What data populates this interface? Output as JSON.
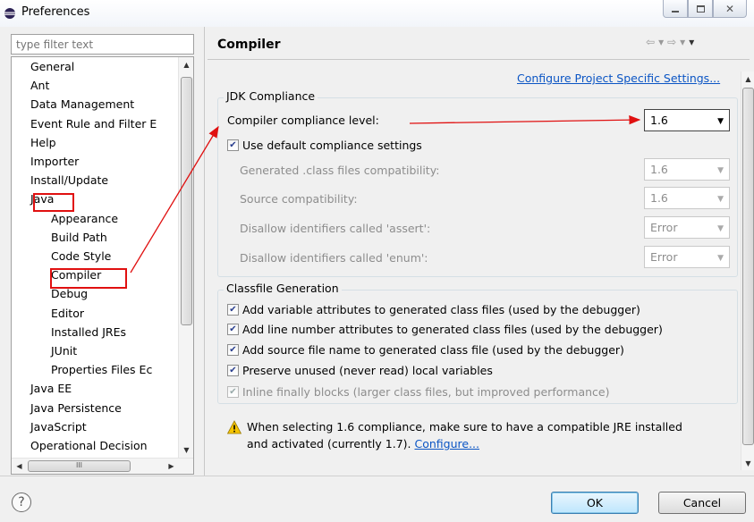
{
  "window": {
    "title": "Preferences"
  },
  "filter": {
    "placeholder": "type filter text"
  },
  "tree": {
    "items": [
      {
        "label": "General",
        "level": 0
      },
      {
        "label": "Ant",
        "level": 0
      },
      {
        "label": "Data Management",
        "level": 0
      },
      {
        "label": "Event Rule and Filter E",
        "level": 0
      },
      {
        "label": "Help",
        "level": 0
      },
      {
        "label": "Importer",
        "level": 0
      },
      {
        "label": "Install/Update",
        "level": 0
      },
      {
        "label": "Java",
        "level": 0,
        "highlight": true
      },
      {
        "label": "Appearance",
        "level": 1
      },
      {
        "label": "Build Path",
        "level": 1
      },
      {
        "label": "Code Style",
        "level": 1
      },
      {
        "label": "Compiler",
        "level": 1,
        "selected": true
      },
      {
        "label": "Debug",
        "level": 1
      },
      {
        "label": "Editor",
        "level": 1
      },
      {
        "label": "Installed JREs",
        "level": 1
      },
      {
        "label": "JUnit",
        "level": 1
      },
      {
        "label": "Properties Files Ec",
        "level": 1
      },
      {
        "label": "Java EE",
        "level": 0
      },
      {
        "label": "Java Persistence",
        "level": 0
      },
      {
        "label": "JavaScript",
        "level": 0
      },
      {
        "label": "Operational Decision",
        "level": 0
      }
    ],
    "hscroll_grip": "III"
  },
  "page": {
    "title": "Compiler",
    "project_link": "Configure Project Specific Settings...",
    "jdk_group": {
      "label": "JDK Compliance",
      "compliance_label": "Compiler compliance level:",
      "compliance_value": "1.6",
      "use_default_label": "Use default compliance settings",
      "use_default_checked": true,
      "rows": [
        {
          "label": "Generated .class files compatibility:",
          "value": "1.6"
        },
        {
          "label": "Source compatibility:",
          "value": "1.6"
        },
        {
          "label": "Disallow identifiers called 'assert':",
          "value": "Error"
        },
        {
          "label": "Disallow identifiers called 'enum':",
          "value": "Error"
        }
      ]
    },
    "classfile_group": {
      "label": "Classfile Generation",
      "options": [
        {
          "label": "Add variable attributes to generated class files (used by the debugger)",
          "checked": true,
          "enabled": true
        },
        {
          "label": "Add line number attributes to generated class files (used by the debugger)",
          "checked": true,
          "enabled": true
        },
        {
          "label": "Add source file name to generated class file (used by the debugger)",
          "checked": true,
          "enabled": true
        },
        {
          "label": "Preserve unused (never read) local variables",
          "checked": true,
          "enabled": true
        },
        {
          "label": "Inline finally blocks (larger class files, but improved performance)",
          "checked": true,
          "enabled": false
        }
      ]
    },
    "warning": {
      "text_line1": "When selecting 1.6 compliance, make sure to have a compatible JRE installed",
      "text_line2": "and activated (currently 1.7). ",
      "link": "Configure..."
    }
  },
  "buttons": {
    "ok": "OK",
    "cancel": "Cancel"
  },
  "colors": {
    "annotation_red": "#e01010",
    "link": "#0b55c4"
  }
}
